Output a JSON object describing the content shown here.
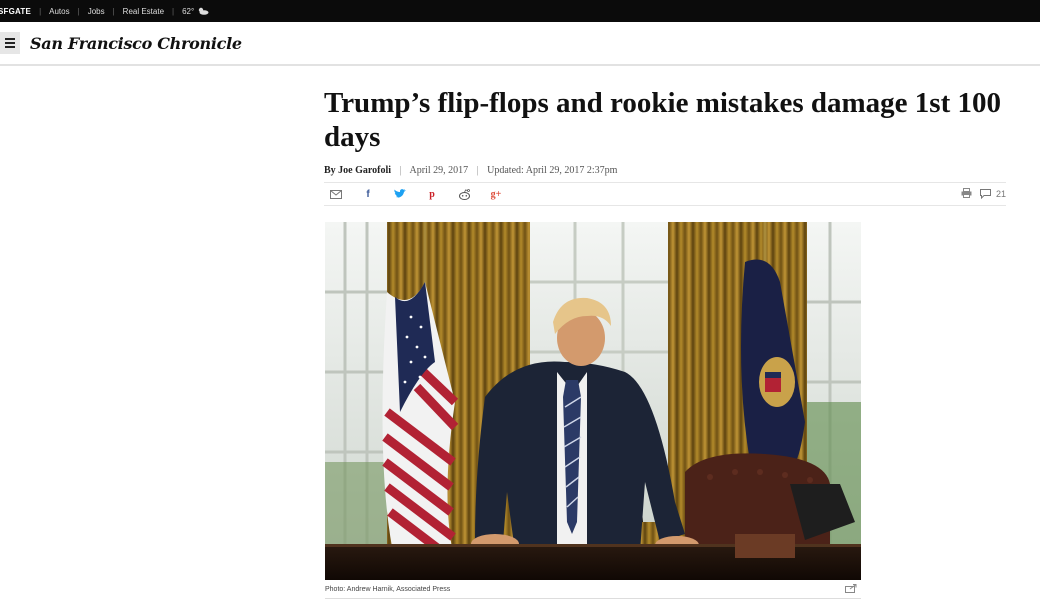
{
  "topbar": {
    "brand": "SFGATE",
    "links": [
      "Autos",
      "Jobs",
      "Real Estate"
    ],
    "weather": "62°",
    "weather_icon": "cloud-sun-icon"
  },
  "masthead": {
    "logo": "San Francisco Chronicle",
    "menu_icon": "hamburger-icon"
  },
  "article": {
    "headline": "Trump’s flip-flops and rookie mistakes damage 1st 100 days",
    "author": "By Joe Garofoli",
    "date": "April 29, 2017",
    "updated": "Updated: April 29, 2017 2:37pm",
    "comment_count": "21",
    "share_icons": [
      "email-icon",
      "facebook-icon",
      "twitter-icon",
      "pinterest-icon",
      "reddit-icon",
      "google-plus-icon"
    ],
    "photo_caption": "Photo: Andrew Harnik, Associated Press"
  },
  "colors": {
    "topbar_bg": "#0b0b0b",
    "facebook": "#3b5998",
    "twitter": "#1da1f2",
    "pinterest": "#cb2027",
    "reddit": "#555555",
    "google_plus": "#dd4b39"
  }
}
